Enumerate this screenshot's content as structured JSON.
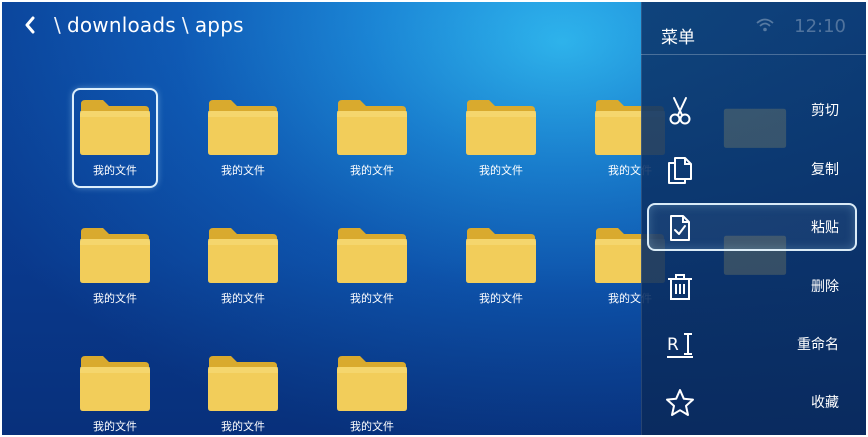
{
  "breadcrumb": {
    "segments": [
      "downloads",
      "apps"
    ],
    "separator": "\\"
  },
  "folders": [
    {
      "label": "我的文件",
      "selected": true
    },
    {
      "label": "我的文件"
    },
    {
      "label": "我的文件"
    },
    {
      "label": "我的文件"
    },
    {
      "label": "我的文件"
    },
    {
      "label": "我的文件"
    },
    {
      "label": "我的文件"
    },
    {
      "label": "我的文件"
    },
    {
      "label": "我的文件"
    },
    {
      "label": "我的文件"
    },
    {
      "label": "我的文件"
    },
    {
      "label": "我的文件"
    },
    {
      "label": "我的文件"
    }
  ],
  "status": {
    "time": "12:10"
  },
  "menu": {
    "title": "菜单",
    "items": [
      {
        "label": "剪切",
        "icon": "scissors-icon"
      },
      {
        "label": "复制",
        "icon": "copy-icon"
      },
      {
        "label": "粘贴",
        "icon": "paste-icon",
        "active": true
      },
      {
        "label": "删除",
        "icon": "trash-icon"
      },
      {
        "label": "重命名",
        "icon": "rename-icon"
      },
      {
        "label": "收藏",
        "icon": "star-icon"
      }
    ]
  },
  "colors": {
    "folder": "#f2cd5a",
    "folder_dark": "#d9aa2e",
    "panel": "#0c376e"
  }
}
